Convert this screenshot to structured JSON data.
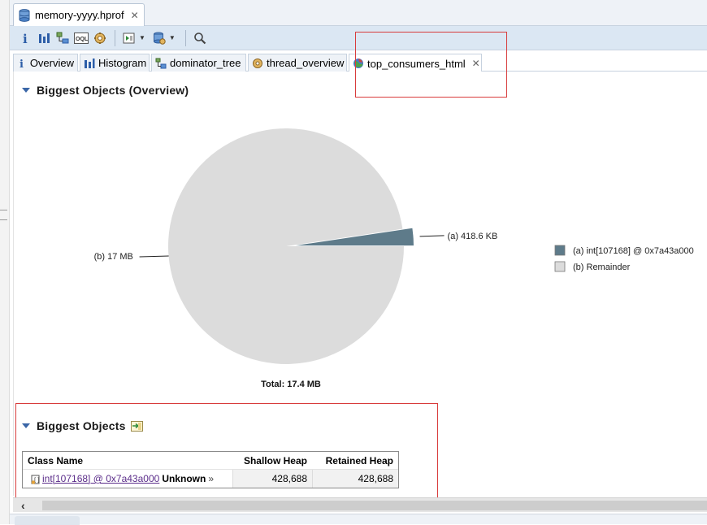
{
  "file_tab": {
    "label": "memory-yyyy.hprof",
    "close": "✕"
  },
  "toolbar": {
    "icons": [
      "info-icon",
      "histogram-icon",
      "dominator-tree-icon",
      "oql-icon",
      "thread-overview-icon",
      "run-query-icon",
      "heap-dump-icon",
      "search-icon"
    ]
  },
  "tabs": [
    {
      "label": "Overview",
      "icon": "info-icon"
    },
    {
      "label": "Histogram",
      "icon": "histogram-icon"
    },
    {
      "label": "dominator_tree",
      "icon": "dominator-tree-icon"
    },
    {
      "label": "thread_overview",
      "icon": "thread-overview-icon"
    },
    {
      "label": "top_consumers_html",
      "icon": "globe-icon",
      "active": true,
      "close": "✕"
    }
  ],
  "overview": {
    "title": "Biggest Objects (Overview)"
  },
  "chart_data": {
    "type": "pie",
    "slices": [
      {
        "label": "(a)",
        "value_label": "418.6 KB",
        "value_kb": 418.6,
        "color": "#5e7b8a",
        "legend": "int[107168] @ 0x7a43a000"
      },
      {
        "label": "(b)",
        "value_label": "17 MB",
        "value_kb": 17408,
        "color": "#dcdcdc",
        "legend": "Remainder"
      }
    ],
    "total_label": "Total: 17.4 MB",
    "legend_position": "right"
  },
  "biggest_objects": {
    "title": "Biggest Objects",
    "columns": [
      "Class Name",
      "Shallow Heap",
      "Retained Heap"
    ],
    "rows": [
      {
        "name": "int[107168] @ 0x7a43a000",
        "type": "Unknown",
        "more": "»",
        "shallow": "428,688",
        "retained": "428,688"
      }
    ]
  },
  "colors": {
    "highlight_box": "#d83b3b",
    "section_triangle": "#3a66a7",
    "link": "#5b2d8a"
  }
}
